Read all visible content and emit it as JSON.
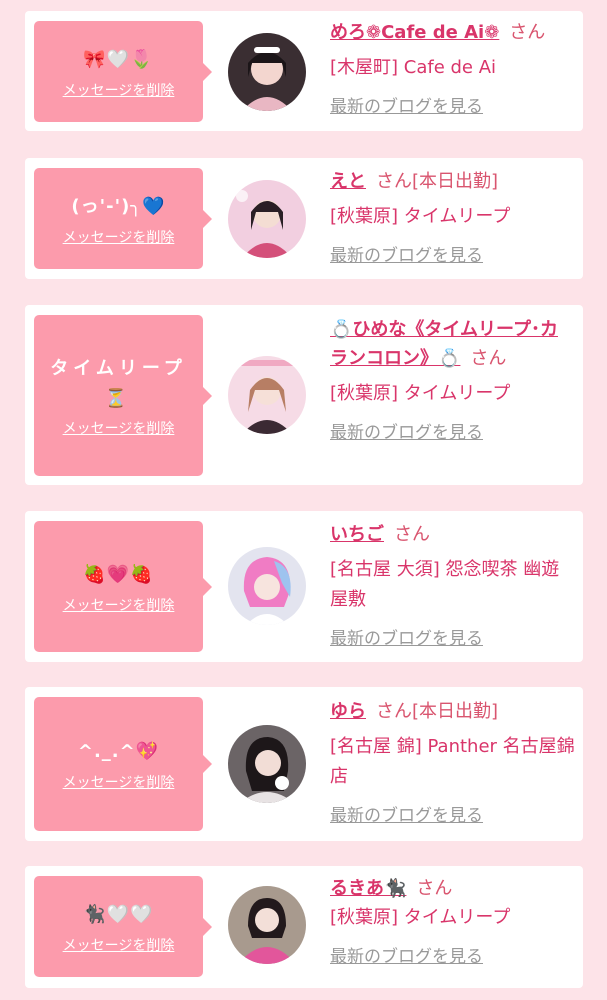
{
  "delete_label": "メッセージを削除",
  "blog_label": "最新のブログを見る",
  "honorific": "さん",
  "colors": {
    "page_bg": "#fde3e8",
    "card_bg": "#ffffff",
    "message_box": "#fc9bac",
    "name_text": "#d9356a",
    "link_gray": "#999999"
  },
  "cards": [
    {
      "message": "🎀🤍🌷",
      "name": "めろ❁Cafe de Ai❁",
      "status": "",
      "shop": "[木屋町] Cafe de Ai",
      "avatar_icon": "profile-photo"
    },
    {
      "message": "(っ'-')╮💙",
      "name": "えと",
      "status": "[本日出勤]",
      "shop": "[秋葉原] タイムリープ",
      "avatar_icon": "profile-photo"
    },
    {
      "message": "タイムリープ⏳",
      "name": "💍ひめな《タイムリープ･カランコロン》💍",
      "status": "",
      "shop": "[秋葉原] タイムリープ",
      "avatar_icon": "profile-photo"
    },
    {
      "message": "🍓💗🍓",
      "name": "いちご",
      "status": "",
      "shop": "[名古屋 大須] 怨念喫茶 幽遊屋敷",
      "avatar_icon": "profile-photo"
    },
    {
      "message": "^._.^💖",
      "name": "ゆら",
      "status": "[本日出勤]",
      "shop": "[名古屋 錦] Panther 名古屋錦店",
      "avatar_icon": "profile-photo"
    },
    {
      "message": "🐈‍⬛🤍🤍",
      "name": "るきあ🐈‍⬛",
      "status": "",
      "shop": "[秋葉原] タイムリープ",
      "avatar_icon": "profile-photo"
    }
  ]
}
